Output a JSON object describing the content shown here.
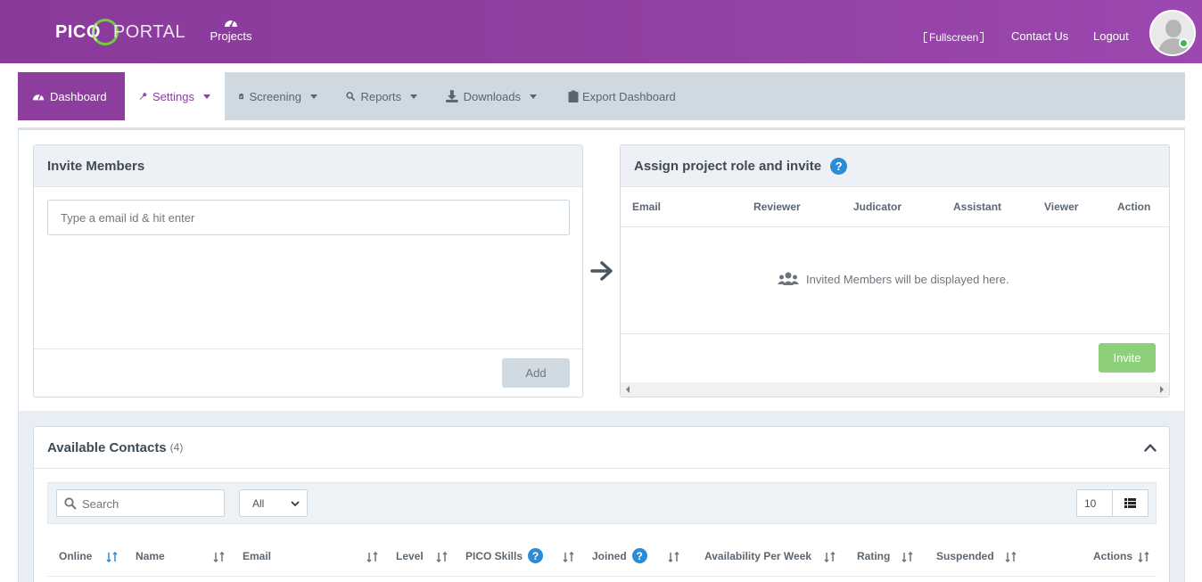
{
  "header": {
    "logo_pico": "PICO",
    "logo_portal": "PORTAL",
    "projects_label": "Projects",
    "fullscreen_label": "Fullscreen",
    "contact_label": "Contact Us",
    "logout_label": "Logout"
  },
  "tabs": [
    {
      "label": "Dashboard",
      "icon": "gauge-icon"
    },
    {
      "label": "Settings",
      "icon": "wrench-icon"
    },
    {
      "label": "Screening",
      "icon": "clipboard-check-icon"
    },
    {
      "label": "Reports",
      "icon": "search-icon"
    },
    {
      "label": "Downloads",
      "icon": "download-icon"
    },
    {
      "label": "Export Dashboard",
      "icon": "clipboard-icon"
    }
  ],
  "invite": {
    "title": "Invite Members",
    "placeholder": "Type a email id & hit enter",
    "add_label": "Add"
  },
  "assign": {
    "title": "Assign project role and invite",
    "help": "?",
    "columns": [
      "Email",
      "Reviewer",
      "Judicator",
      "Assistant",
      "Viewer",
      "Action"
    ],
    "empty_message": "Invited Members will be displayed here.",
    "invite_label": "Invite"
  },
  "contacts": {
    "title": "Available Contacts",
    "count": "(4)",
    "search_placeholder": "Search",
    "filter_value": "All",
    "page_size": "10",
    "columns": [
      "Online",
      "Name",
      "Email",
      "Level",
      "PICO Skills",
      "Joined",
      "Availability Per Week",
      "Rating",
      "Suspended",
      "Actions"
    ]
  },
  "colors": {
    "brand_purple": "#8d3d9d",
    "accent_green": "#8ed07a",
    "help_blue": "#2a8bd6"
  }
}
